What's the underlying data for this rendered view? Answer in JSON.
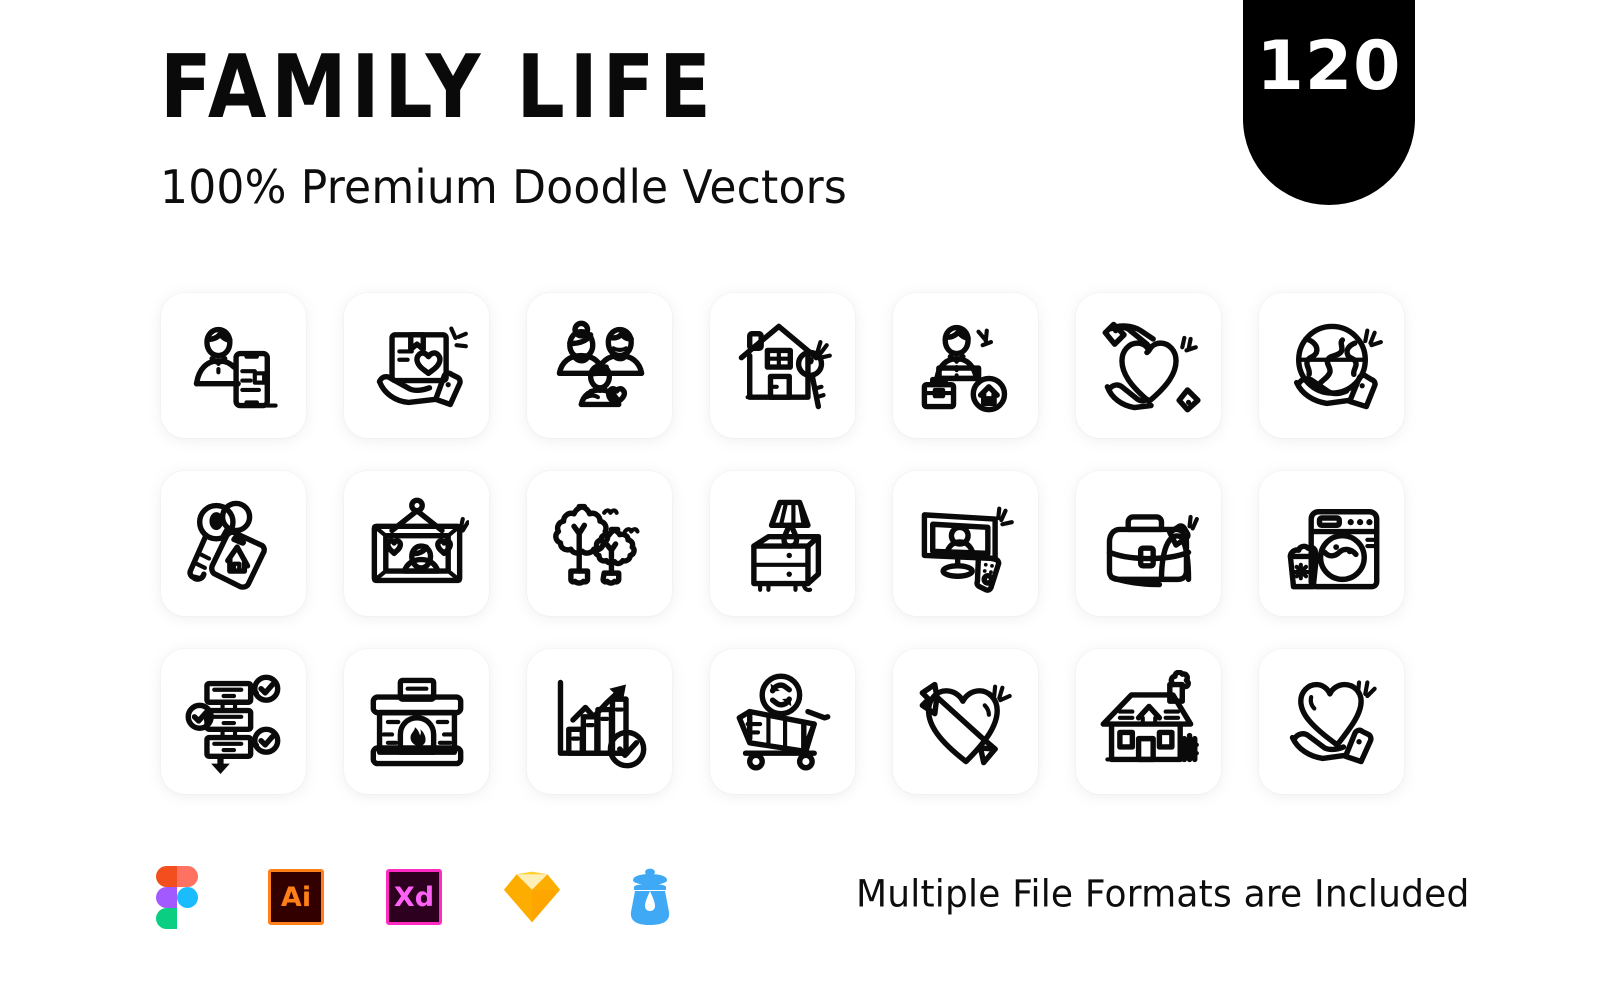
{
  "header": {
    "title": "FAMILY LIFE",
    "subtitle": "100% Premium Doodle Vectors",
    "badge_count": "120",
    "badge_color": "#000000",
    "badge_text_color": "#ffffff"
  },
  "page": {
    "background": "#ffffff",
    "text_color": "#0a0a0a",
    "card_background": "#ffffff",
    "icon_stroke": "#0a0a0a"
  },
  "grid": {
    "columns": 7,
    "rows": 3,
    "icons": [
      {
        "name": "person-with-smartphone-icon",
        "label": "Person with smartphone"
      },
      {
        "name": "hand-holding-parcel-heart-icon",
        "label": "Hand holding parcel with heart"
      },
      {
        "name": "family-parents-child-icon",
        "label": "Family parents and child"
      },
      {
        "name": "house-with-key-icon",
        "label": "House with key"
      },
      {
        "name": "work-life-balance-icon",
        "label": "Work life balance"
      },
      {
        "name": "hands-holding-heart-icon",
        "label": "Hands holding heart"
      },
      {
        "name": "hand-holding-globe-icon",
        "label": "Hand holding globe"
      },
      {
        "name": "house-keys-tag-icon",
        "label": "House keys with tag"
      },
      {
        "name": "family-photo-frame-icon",
        "label": "Family photo frame"
      },
      {
        "name": "trees-with-birds-icon",
        "label": "Trees with birds"
      },
      {
        "name": "nightstand-lamp-icon",
        "label": "Nightstand with lamp"
      },
      {
        "name": "television-remote-icon",
        "label": "Television with remote"
      },
      {
        "name": "briefcase-bag-icon",
        "label": "Briefcase bag"
      },
      {
        "name": "washing-machine-laundry-icon",
        "label": "Washing machine with laundry"
      },
      {
        "name": "workflow-checklist-icon",
        "label": "Workflow checklist"
      },
      {
        "name": "fireplace-icon",
        "label": "Fireplace"
      },
      {
        "name": "growth-chart-check-icon",
        "label": "Growth chart with check"
      },
      {
        "name": "shopping-cart-refresh-icon",
        "label": "Shopping cart refresh"
      },
      {
        "name": "heart-with-arrow-icon",
        "label": "Heart with arrow"
      },
      {
        "name": "house-chimney-fence-icon",
        "label": "House with chimney and fence"
      },
      {
        "name": "hand-holding-heart-icon",
        "label": "Hand holding heart"
      }
    ]
  },
  "footer": {
    "note": "Multiple File Formats are Included",
    "formats": [
      {
        "name": "figma-icon",
        "label": "Figma"
      },
      {
        "name": "illustrator-icon",
        "label": "Ai",
        "color": "#ff7f18",
        "background": "#330000"
      },
      {
        "name": "xd-icon",
        "label": "Xd",
        "color": "#ff61f6",
        "background": "#2e001f"
      },
      {
        "name": "sketch-icon",
        "label": "Sketch",
        "color": "#fdad00"
      },
      {
        "name": "inkscape-icon",
        "label": "Inkscape",
        "color": "#3fa9f5"
      }
    ]
  }
}
